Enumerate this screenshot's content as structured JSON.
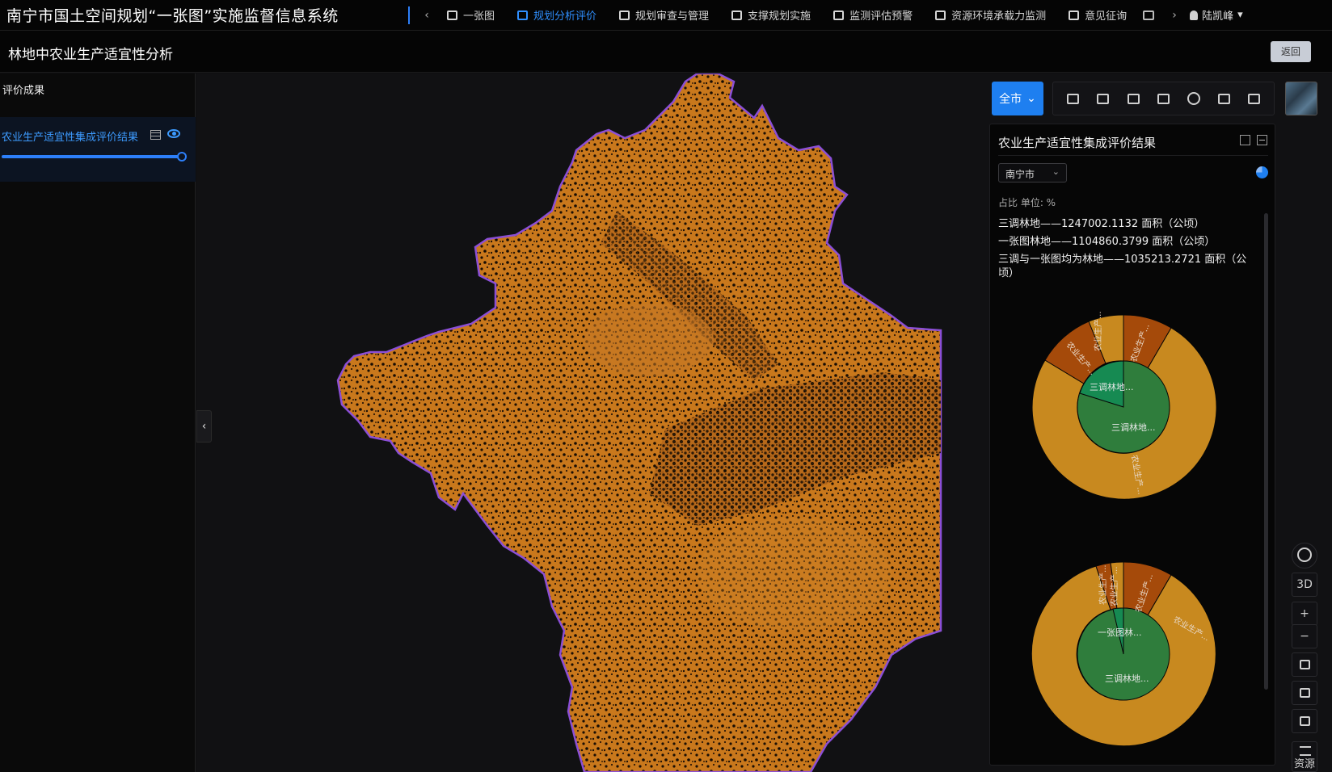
{
  "app": {
    "title": "南宁市国土空间规划“一张图”实施监督信息系统"
  },
  "nav": {
    "prev_arrow": "‹",
    "next_arrow": "›",
    "items": [
      {
        "label": "一张图",
        "icon": "book-icon"
      },
      {
        "label": "规划分析评价",
        "icon": "briefcase-icon",
        "active": true
      },
      {
        "label": "规划审查与管理",
        "icon": "edit-icon"
      },
      {
        "label": "支撑规划实施",
        "icon": "user-gear-icon"
      },
      {
        "label": "监测评估预警",
        "icon": "monitor-icon"
      },
      {
        "label": "资源环境承载力监测",
        "icon": "monitor-icon"
      },
      {
        "label": "意见征询",
        "icon": "form-icon"
      }
    ],
    "user": "陆凯峰",
    "user_caret": "▾"
  },
  "subheader": {
    "title": "林地中农业生产适宜性分析",
    "back_label": "返回"
  },
  "left_panel": {
    "heading": "评价成果",
    "layer": {
      "name": "农业生产适宜性集成评价结果",
      "opacity": 1.0
    },
    "collapse_arrow": "‹"
  },
  "map_toolbar": {
    "area_select": "全市",
    "tools": [
      "list-icon",
      "layers-icon",
      "layers-stack-icon",
      "layout-icon",
      "info-icon",
      "image-icon",
      "toolbox-icon"
    ]
  },
  "result_panel": {
    "title": "农业生产适宜性集成评价结果",
    "city": "南宁市",
    "unit_text": "占比 单位: %",
    "stats": [
      "三调林地——1247002.1132 面积（公顷）",
      "一张图林地——1104860.3799 面积（公顷）",
      "三调与一张图均为林地——1035213.2721 面积（公顷）"
    ],
    "charts": [
      {
        "inner_labels": [
          "三调林地...",
          "三调林地..."
        ],
        "outer_labels": [
          "农业生产...",
          "农业生产...",
          "农业生产...",
          "农业生产..."
        ]
      },
      {
        "inner_labels": [
          "一张图林...",
          "三调林地..."
        ],
        "outer_labels": [
          "农业生产...",
          "农业生产...",
          "农业生产...",
          "农业生产..."
        ]
      }
    ]
  },
  "side_controls": {
    "three_d": "3D",
    "zoom_in": "+",
    "zoom_out": "−",
    "resource": "资源"
  },
  "colors": {
    "accent": "#1e7ff0",
    "map_fill": "#c9781c",
    "boundary": "#8b4fd6",
    "pie_gold": "#c8891f",
    "pie_dark": "#a54a0a",
    "pie_green": "#2f7d3c",
    "pie_teal": "#168a52"
  }
}
